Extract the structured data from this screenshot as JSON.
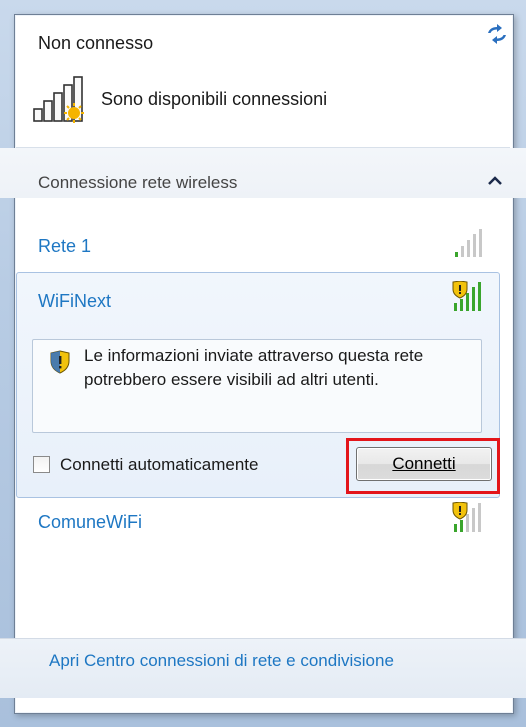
{
  "status": {
    "title": "Non connesso",
    "available": "Sono disponibili connessioni"
  },
  "section": {
    "title": "Connessione rete wireless"
  },
  "networks": [
    {
      "name": "Rete 1",
      "secured": false,
      "signal_bars": 5
    },
    {
      "name": "WiFiNext",
      "secured": true,
      "signal_bars": 5,
      "selected": true
    },
    {
      "name": "ComuneWiFi",
      "secured": true,
      "signal_bars": 5
    }
  ],
  "selected_network": {
    "warning": "Le informazioni inviate attraverso questa rete potrebbero essere visibili ad altri utenti.",
    "auto_connect_label": "Connetti automaticamente",
    "auto_connect_checked": false,
    "connect_button": "Connetti"
  },
  "footer": {
    "link": "Apri Centro connessioni di rete e condivisione"
  },
  "colors": {
    "link_blue": "#1e77c3",
    "highlight_red": "#e3151a",
    "signal_green": "#3aa52c"
  },
  "icons": {
    "refresh": "refresh-arrows-icon",
    "available": "signal-bars-sun-icon",
    "collapse": "chevron-up-icon",
    "signal": "wifi-signal-icon",
    "shield": "shield-warning-icon"
  }
}
